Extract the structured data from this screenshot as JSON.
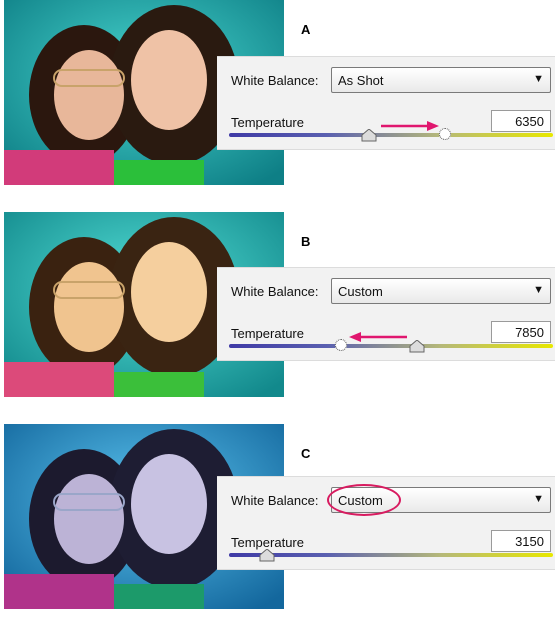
{
  "panels": [
    {
      "letter": "A",
      "white_balance_label": "White Balance:",
      "white_balance_value": "As Shot",
      "temperature_label": "Temperature",
      "temperature_value": "6350",
      "colors": {
        "photo_background": "#1aa7a8"
      }
    },
    {
      "letter": "B",
      "white_balance_label": "White Balance:",
      "white_balance_value": "Custom",
      "temperature_label": "Temperature",
      "temperature_value": "7850",
      "colors": {
        "photo_background": "#21b3b4"
      }
    },
    {
      "letter": "C",
      "white_balance_label": "White Balance:",
      "white_balance_value": "Custom",
      "temperature_label": "Temperature",
      "temperature_value": "3150",
      "colors": {
        "photo_background": "#1f8fc9"
      }
    }
  ],
  "colors": {
    "annotation_arrow": "#e0176f",
    "slider_cool": "#3f3aa6",
    "slider_warm": "#e8e800"
  }
}
